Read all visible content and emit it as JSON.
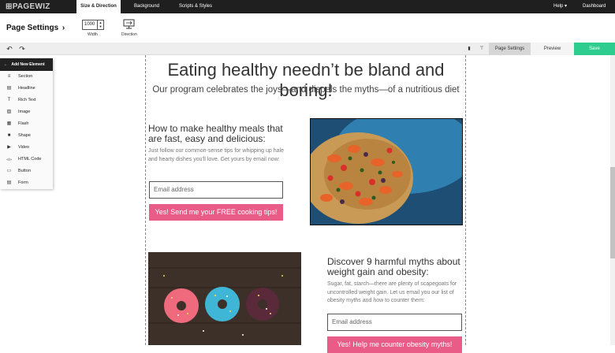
{
  "app": {
    "logo": "PAGEWIZ",
    "tabs": [
      {
        "label": "Size & Direction",
        "active": true
      },
      {
        "label": "Background",
        "active": false
      },
      {
        "label": "Scripts & Styles",
        "active": false
      }
    ],
    "help_label": "Help ▾",
    "dashboard_label": "Dashboard"
  },
  "settings": {
    "title": "Page Settings",
    "chevron": "›",
    "width_value": "1000",
    "width_label": "Width",
    "direction_label": "Direction"
  },
  "toolbar": {
    "page_settings_label": "Page Settings",
    "preview_label": "Preview",
    "save_label": "Save",
    "save_color": "#2ecc8f"
  },
  "sidebar": {
    "header": "Add New Element",
    "items": [
      {
        "label": "Section",
        "icon": "≡"
      },
      {
        "label": "Headline",
        "icon": "▤"
      },
      {
        "label": "Rich Text",
        "icon": "T"
      },
      {
        "label": "Image",
        "icon": "▨"
      },
      {
        "label": "Flash",
        "icon": "▦"
      },
      {
        "label": "Shape",
        "icon": "■"
      },
      {
        "label": "Video",
        "icon": "▶"
      },
      {
        "label": "HTML Code",
        "icon": "</>"
      },
      {
        "label": "Button",
        "icon": "▭"
      },
      {
        "label": "Form",
        "icon": "▤"
      }
    ]
  },
  "page": {
    "headline": "Eating healthy needn’t be bland and boring!",
    "subheadline": "Our program celebrates the joys—and dispels the myths—of a nutritious diet",
    "section1": {
      "title": "How to make healthy meals that are fast, easy and delicious:",
      "body": "Just follow our common-sense tips for whipping up hale and hearty dishes you'll love. Get yours by email now:",
      "email_placeholder": "Email address",
      "cta": "Yes! Send me your FREE cooking tips!"
    },
    "section2": {
      "title": "Discover 9 harmful myths about weight gain and obesity:",
      "body": "Sugar, fat, starch—there are plenty of scapegoats for uncontrolled weight gain. Let us email you our list of obesity myths and how to counter them:",
      "email_placeholder": "Email address",
      "cta": "Yes! Help me counter obesity myths!"
    },
    "accent_color": "#ea5c88"
  }
}
